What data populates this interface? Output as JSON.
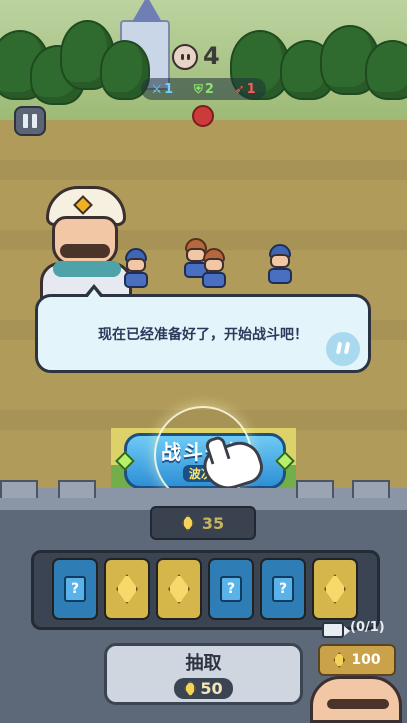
{
  "hud": {
    "enemy_count": "4",
    "stats": [
      {
        "icon": "sword-icon",
        "value": "1",
        "color": "#6fd3ff"
      },
      {
        "icon": "shield-icon",
        "value": "2",
        "color": "#8be36b"
      },
      {
        "icon": "arrow-icon",
        "value": "1",
        "color": "#ff5a5a"
      }
    ]
  },
  "dialog": {
    "text": "现在已经准备好了，开始战斗吧！"
  },
  "start_button": {
    "main_label": "战斗开始",
    "sub_label": "波次1"
  },
  "cost_slot": {
    "value": "35"
  },
  "cards": [
    {
      "type": "blue",
      "glyph": "?"
    },
    {
      "type": "gold"
    },
    {
      "type": "gold"
    },
    {
      "type": "blue",
      "glyph": "?"
    },
    {
      "type": "blue",
      "glyph": "?"
    },
    {
      "type": "gold"
    }
  ],
  "draw_button": {
    "label": "抽取",
    "cost": "50"
  },
  "ad_reward": {
    "count": "(0/1)",
    "value": "100"
  },
  "colors": {
    "accent_blue": "#2e8fd6",
    "gold": "#f3d35a",
    "dialog_bg": "#e3f4fb"
  }
}
